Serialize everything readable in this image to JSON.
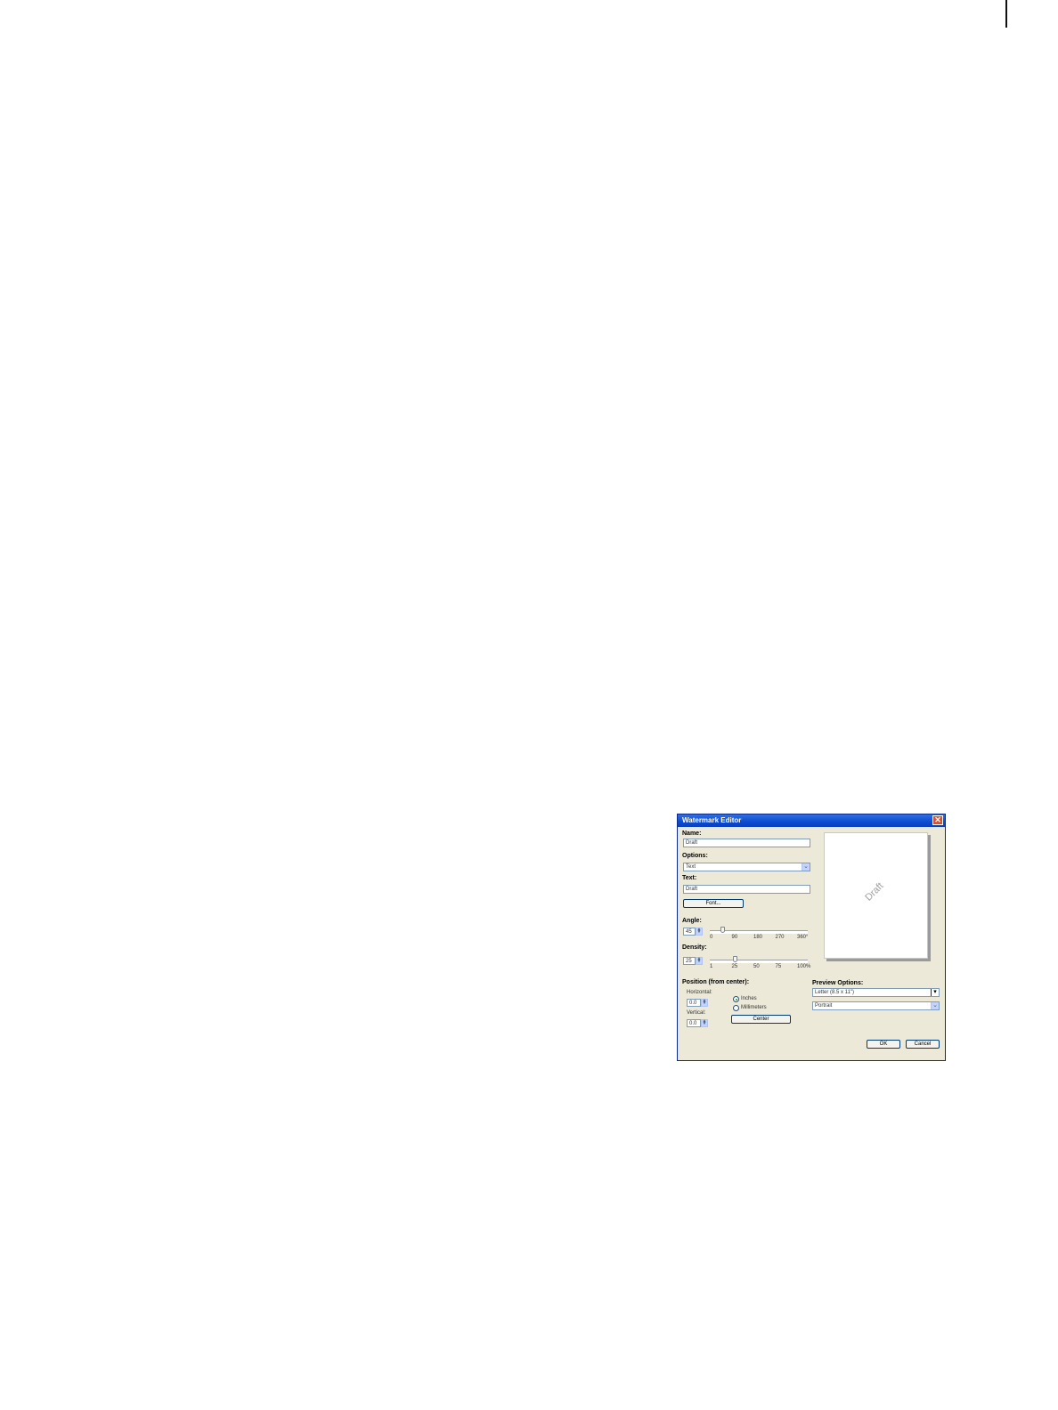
{
  "window": {
    "title": "Watermark Editor"
  },
  "name": {
    "label": "Name:",
    "value": "Draft"
  },
  "options": {
    "label": "Options:",
    "value": "Text"
  },
  "text": {
    "label": "Text:",
    "value": "Draft"
  },
  "font_button": "Font...",
  "angle": {
    "label": "Angle:",
    "value": "45",
    "ticks": [
      "0",
      "90",
      "180",
      "270",
      "360°"
    ],
    "max": 360
  },
  "density": {
    "label": "Density:",
    "value": "25",
    "ticks": [
      "1",
      "25",
      "50",
      "75",
      "100%"
    ],
    "max": 100
  },
  "position": {
    "label": "Position (from center):",
    "horizontal_label": "Horizontal:",
    "horizontal_value": "0.0",
    "vertical_label": "Vertical:",
    "vertical_value": "0.0",
    "units": [
      {
        "label": "Inches",
        "selected": true
      },
      {
        "label": "Millimeters",
        "selected": false
      }
    ],
    "center_button": "Center"
  },
  "preview": {
    "watermark_text": "Draft",
    "options_label": "Preview Options:",
    "paper": "Letter (8.5 x 11\")",
    "orientation": "Portrait"
  },
  "buttons": {
    "ok": "OK",
    "cancel": "Cancel"
  },
  "colors": {
    "titlebar": "#0b4bd2",
    "dialog_bg": "#ece9d8",
    "close": "#d9502f"
  }
}
